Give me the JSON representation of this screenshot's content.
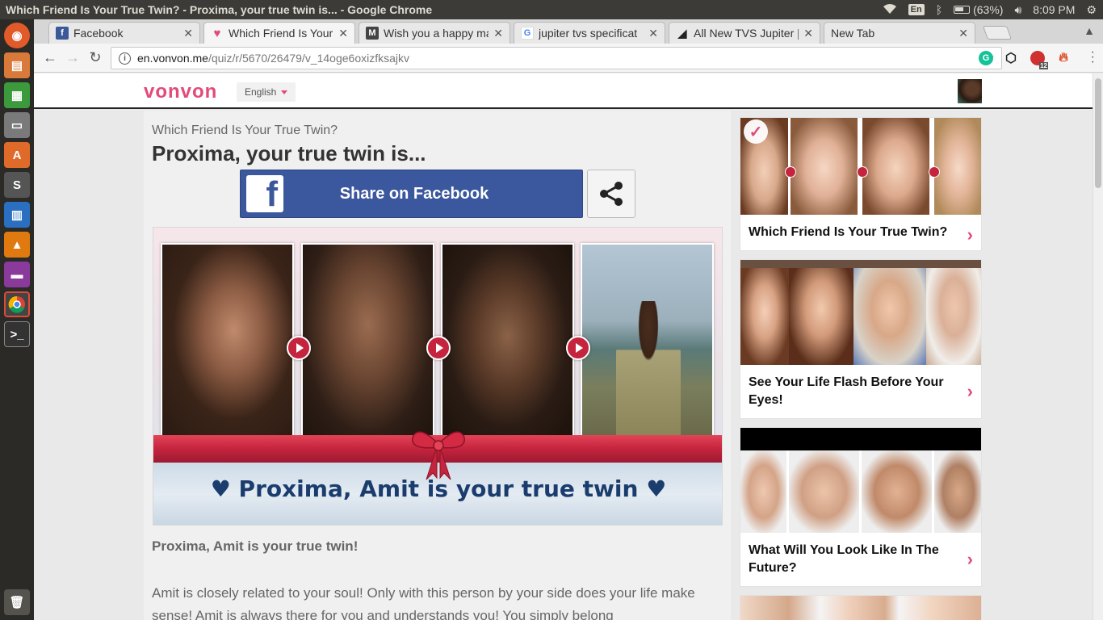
{
  "os": {
    "window_title": "Which Friend Is Your True Twin? - Proxima, your true twin is... - Google Chrome",
    "keyboard_layout": "En",
    "battery": "(63%)",
    "clock": "8:09 PM"
  },
  "browser": {
    "tabs": [
      {
        "label": "Facebook",
        "active": false,
        "favicon_color": "#3b5998",
        "favicon_char": "f"
      },
      {
        "label": "Which Friend Is Your",
        "active": true,
        "favicon_color": "#e34a78",
        "favicon_char": "V"
      },
      {
        "label": "Wish you a happy ma",
        "active": false,
        "favicon_color": "#444444",
        "favicon_char": "M"
      },
      {
        "label": "jupiter tvs specificat",
        "active": false,
        "favicon_color": "#4285f4",
        "favicon_char": "G"
      },
      {
        "label": "All New TVS Jupiter |",
        "active": false,
        "favicon_color": "#222222",
        "favicon_char": "/"
      },
      {
        "label": "New Tab",
        "active": false,
        "favicon_color": "",
        "favicon_char": ""
      }
    ],
    "url_host": "en.vonvon.me",
    "url_path": "/quiz/r/5670/26479/v_14oge6oxizfksajkv",
    "extension_badge": "12"
  },
  "site": {
    "logo": "vonvon",
    "language": "English"
  },
  "quiz": {
    "subtitle": "Which Friend Is Your True Twin?",
    "title": "Proxima, your true twin is...",
    "share_facebook_label": "Share on Facebook",
    "banner_text": "♥ Proxima, Amit is your true twin ♥",
    "result_heading": "Proxima, Amit is your true twin!",
    "result_description": "Amit is closely related to your soul! Only with this person by your side does your life make sense! Amit is always there for you and understands you! You simply belong"
  },
  "sidebar": {
    "cards": [
      {
        "label": "Which Friend Is Your True Twin?"
      },
      {
        "label": "See Your Life Flash Before Your Eyes!"
      },
      {
        "label": "What Will You Look Like In The Future?"
      }
    ]
  },
  "colors": {
    "brand_pink": "#e34a78",
    "facebook_blue": "#3b579d",
    "ribbon_red": "#c5243e",
    "banner_text_blue": "#1a3d6e"
  }
}
